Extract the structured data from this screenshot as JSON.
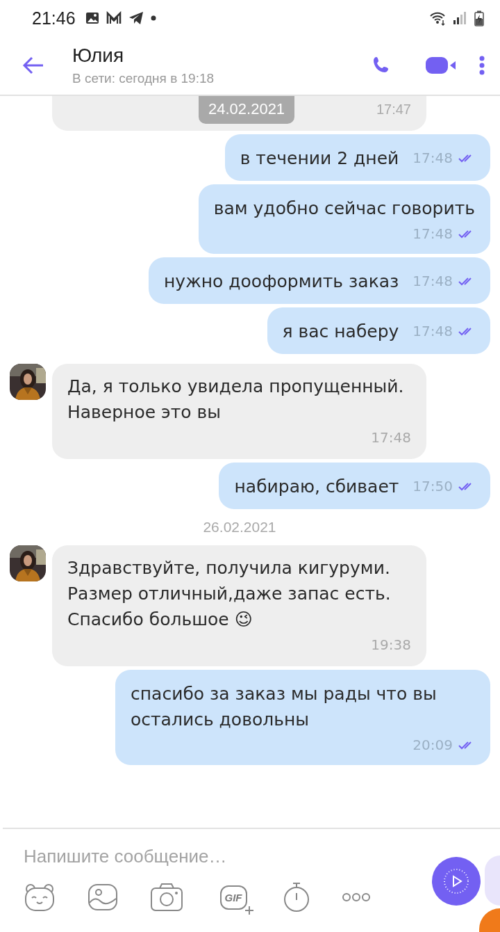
{
  "status_bar": {
    "time": "21:46"
  },
  "header": {
    "title": "Юлия",
    "subtitle": "В сети: сегодня в 19:18"
  },
  "messages": [
    {
      "kind": "clipped",
      "date": "24.02.2021",
      "time": "17:47"
    },
    {
      "kind": "outgoing",
      "text": "в течении 2 дней",
      "time": "17:48",
      "read": true
    },
    {
      "kind": "outgoing",
      "text": "вам удобно сейчас говорить",
      "time": "17:48",
      "read": true,
      "wrap": true
    },
    {
      "kind": "outgoing",
      "text": "нужно дооформить заказ",
      "time": "17:48",
      "read": true
    },
    {
      "kind": "outgoing",
      "text": "я вас наберу",
      "time": "17:48",
      "read": true
    },
    {
      "kind": "incoming",
      "text": "Да, я только увидела пропущенный. Наверное это вы",
      "time": "17:48"
    },
    {
      "kind": "outgoing",
      "text": "набираю, сбивает",
      "time": "17:50",
      "read": true
    },
    {
      "kind": "date",
      "text": "26.02.2021"
    },
    {
      "kind": "incoming",
      "text": "Здравствуйте, получила кигуруми. Размер отличный,даже запас есть. Спасибо большое 😉",
      "time": "19:38"
    },
    {
      "kind": "outgoing",
      "text": "спасибо за заказ мы рады что вы остались довольны",
      "time": "20:09",
      "read": true,
      "wrap": true
    }
  ],
  "composer": {
    "placeholder": "Напишите сообщение…"
  },
  "toolbar": [
    {
      "kind": "sticker"
    },
    {
      "kind": "gallery"
    },
    {
      "kind": "camera"
    },
    {
      "kind": "gif",
      "label": "GIF"
    },
    {
      "kind": "timer"
    },
    {
      "kind": "more"
    }
  ]
}
